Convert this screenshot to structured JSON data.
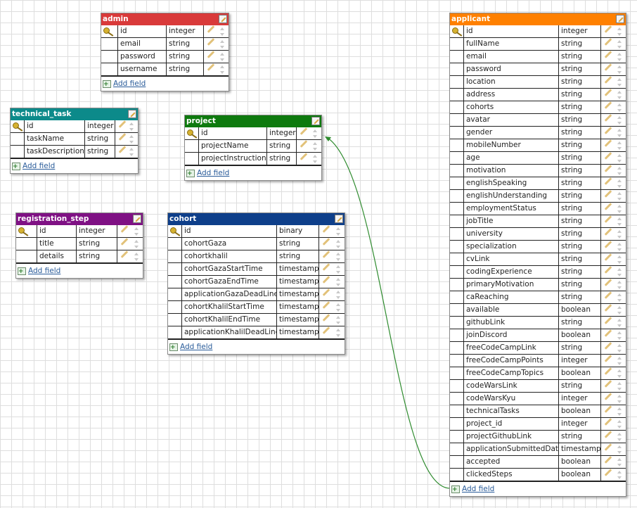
{
  "tables": [
    {
      "name": "admin",
      "color": "#d93a3a",
      "fields": [
        {
          "name": "id",
          "type": "integer",
          "pk": true
        },
        {
          "name": "email",
          "type": "string"
        },
        {
          "name": "password",
          "type": "string"
        },
        {
          "name": "username",
          "type": "string"
        }
      ],
      "add_label": "Add field"
    },
    {
      "name": "technical_task",
      "color": "#0c8a8a",
      "fields": [
        {
          "name": "id",
          "type": "integer",
          "pk": true
        },
        {
          "name": "taskName",
          "type": "string"
        },
        {
          "name": "taskDescription",
          "type": "string"
        }
      ],
      "add_label": "Add field"
    },
    {
      "name": "project",
      "color": "#0e7a0e",
      "fields": [
        {
          "name": "id",
          "type": "integer",
          "pk": true
        },
        {
          "name": "projectName",
          "type": "string"
        },
        {
          "name": "projectInstructions",
          "type": "string"
        }
      ],
      "add_label": "Add field"
    },
    {
      "name": "registration_step",
      "color": "#7f1184",
      "fields": [
        {
          "name": "id",
          "type": "integer",
          "pk": true
        },
        {
          "name": "title",
          "type": "string"
        },
        {
          "name": "details",
          "type": "string"
        }
      ],
      "add_label": "Add field"
    },
    {
      "name": "cohort",
      "color": "#0e3f8a",
      "fields": [
        {
          "name": "id",
          "type": "binary",
          "pk": true
        },
        {
          "name": "cohortGaza",
          "type": "string"
        },
        {
          "name": "cohortkhalil",
          "type": "string"
        },
        {
          "name": "cohortGazaStartTime",
          "type": "timestamp"
        },
        {
          "name": "cohortGazaEndTime",
          "type": "timestamp"
        },
        {
          "name": "applicationGazaDeadLine",
          "type": "timestamp"
        },
        {
          "name": "cohortKhalilStartTime",
          "type": "timestamp"
        },
        {
          "name": "cohortKhalilEndTime",
          "type": "timestamp"
        },
        {
          "name": "applicationKhalilDeadLine",
          "type": "timestamp"
        }
      ],
      "add_label": "Add field"
    },
    {
      "name": "applicant",
      "color": "#ff8000",
      "fields": [
        {
          "name": "id",
          "type": "integer",
          "pk": true
        },
        {
          "name": "fullName",
          "type": "string"
        },
        {
          "name": "email",
          "type": "string"
        },
        {
          "name": "password",
          "type": "string"
        },
        {
          "name": "location",
          "type": "string"
        },
        {
          "name": "address",
          "type": "string"
        },
        {
          "name": "cohorts",
          "type": "string"
        },
        {
          "name": "avatar",
          "type": "string"
        },
        {
          "name": "gender",
          "type": "string"
        },
        {
          "name": "mobileNumber",
          "type": "string"
        },
        {
          "name": "age",
          "type": "string"
        },
        {
          "name": "motivation",
          "type": "string"
        },
        {
          "name": "englishSpeaking",
          "type": "string"
        },
        {
          "name": "englishUnderstanding",
          "type": "string"
        },
        {
          "name": "employmentStatus",
          "type": "string"
        },
        {
          "name": "jobTitle",
          "type": "string"
        },
        {
          "name": "university",
          "type": "string"
        },
        {
          "name": "specialization",
          "type": "string"
        },
        {
          "name": "cvLink",
          "type": "string"
        },
        {
          "name": "codingExperience",
          "type": "string"
        },
        {
          "name": "primaryMotivation",
          "type": "string"
        },
        {
          "name": "caReaching",
          "type": "string"
        },
        {
          "name": "available",
          "type": "boolean"
        },
        {
          "name": "githubLink",
          "type": "string"
        },
        {
          "name": "joinDiscord",
          "type": "boolean"
        },
        {
          "name": "freeCodeCampLink",
          "type": "string"
        },
        {
          "name": "freeCodeCampPoints",
          "type": "integer"
        },
        {
          "name": "freeCodeCampTopics",
          "type": "boolean"
        },
        {
          "name": "codeWarsLink",
          "type": "string"
        },
        {
          "name": "codeWarsKyu",
          "type": "integer"
        },
        {
          "name": "technicalTasks",
          "type": "boolean"
        },
        {
          "name": "project_id",
          "type": "integer"
        },
        {
          "name": "projectGithubLink",
          "type": "string"
        },
        {
          "name": "applicationSubmittedDate",
          "type": "timestamp"
        },
        {
          "name": "accepted",
          "type": "boolean"
        },
        {
          "name": "clickedSteps",
          "type": "boolean"
        }
      ],
      "add_label": "Add field"
    }
  ],
  "relation_color": "#2e8b2e"
}
